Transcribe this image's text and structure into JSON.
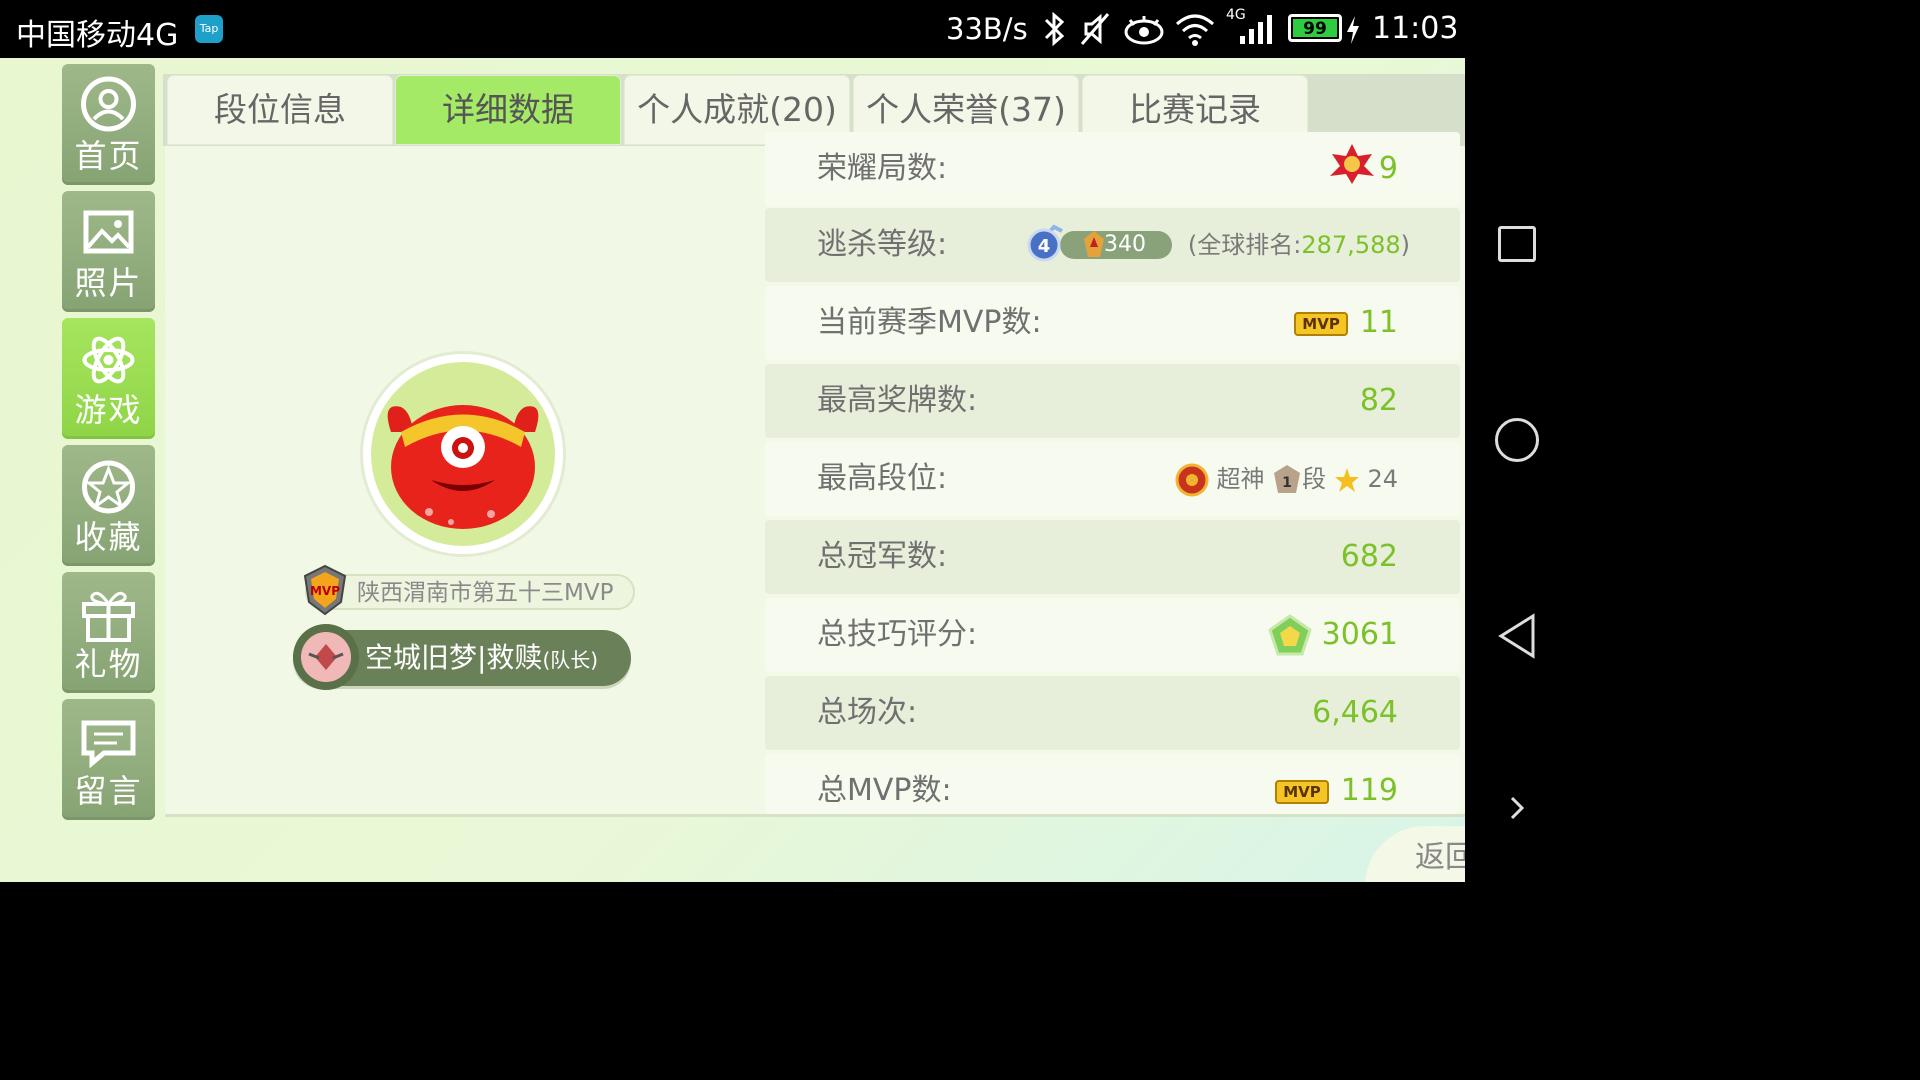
{
  "statusbar": {
    "carrier": "中国移动4G",
    "tap_badge": "Tap",
    "net_speed": "33B/s",
    "network_type": "4G",
    "battery": "99",
    "time": "11:03"
  },
  "sidebar": {
    "items": [
      {
        "label": "首页",
        "icon": "user-icon"
      },
      {
        "label": "照片",
        "icon": "image-icon"
      },
      {
        "label": "游戏",
        "icon": "atom-icon",
        "active": true
      },
      {
        "label": "收藏",
        "icon": "star-wreath-icon"
      },
      {
        "label": "礼物",
        "icon": "gift-icon"
      },
      {
        "label": "留言",
        "icon": "message-icon"
      }
    ]
  },
  "tabs": [
    {
      "label": "段位信息"
    },
    {
      "label": "详细数据",
      "active": true
    },
    {
      "label": "个人成就(20)"
    },
    {
      "label": "个人荣誉(37)"
    },
    {
      "label": "比赛记录"
    }
  ],
  "profile": {
    "mvp_title": "陕西渭南市第五十三MVP",
    "team_name": "空城旧梦|救赎",
    "team_role": "(队长)"
  },
  "stats": {
    "glory_label": "荣耀局数:",
    "glory_value": "9",
    "kill_label": "逃杀等级:",
    "kill_level": "4",
    "kill_value": "340",
    "kill_rank_prefix": "(全球排名:",
    "kill_rank": "287,588",
    "kill_rank_suffix": ")",
    "season_mvp_label": "当前赛季MVP数:",
    "season_mvp_value": "11",
    "medal_label": "最高奖牌数:",
    "medal_value": "82",
    "rank_label": "最高段位:",
    "rank_tier": "超神",
    "rank_num": "1",
    "rank_suffix": "段",
    "rank_stars": "24",
    "champion_label": "总冠军数:",
    "champion_value": "682",
    "skill_label": "总技巧评分:",
    "skill_value": "3061",
    "games_label": "总场次:",
    "games_value": "6,464",
    "total_mvp_label": "总MVP数:",
    "total_mvp_value": "119",
    "mvp_badge": "MVP"
  },
  "back_label": "返回",
  "colors": {
    "accent_green": "#7cc12a",
    "active_tab": "#a4ea67",
    "sidebar": "#8fa97c",
    "sidebar_active": "#96d84f"
  }
}
